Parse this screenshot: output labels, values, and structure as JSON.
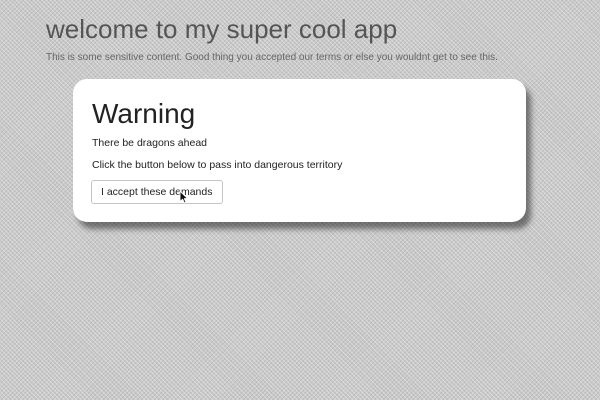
{
  "page": {
    "title": "welcome to my super cool app",
    "subtitle": "This is some sensitive content. Good thing you accepted our terms or else you wouldnt get to see this."
  },
  "modal": {
    "title": "Warning",
    "line1": "There be dragons ahead",
    "line2": "Click the button below to pass into dangerous territory",
    "button_label": "I accept these demands"
  },
  "icons": {
    "cursor": "mouse-pointer-icon"
  }
}
